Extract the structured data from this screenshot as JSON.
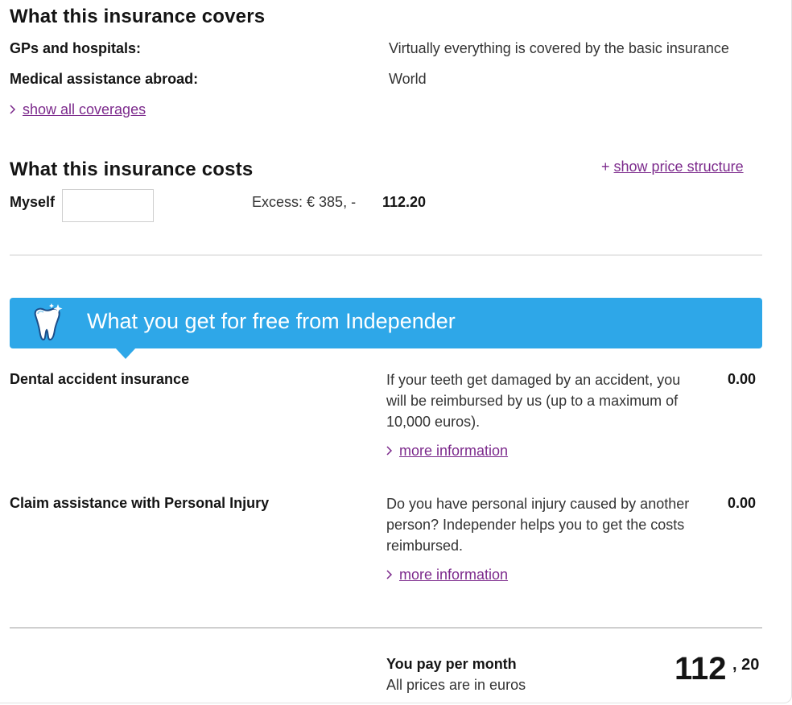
{
  "coverage": {
    "title": "What this insurance covers",
    "rows": [
      {
        "label": "GPs and hospitals:",
        "value": "Virtually everything is covered by the basic insurance"
      },
      {
        "label": "Medical assistance abroad:",
        "value": "World"
      }
    ],
    "show_all_link": "show all coverages"
  },
  "costs": {
    "title": "What this insurance costs",
    "price_structure_prefix": "+",
    "price_structure_link": "show price structure",
    "person_label": "Myself",
    "person_input_value": "",
    "excess": "Excess: € 385, -",
    "amount": "112.20"
  },
  "banner": {
    "title": "What you get for free from Independer",
    "icon": "tooth-sparkle-icon",
    "color": "#2ea7e8"
  },
  "extras": [
    {
      "name": "Dental accident insurance",
      "description": "If your teeth get damaged by an accident, you will be reimbursed by us (up to a maximum of 10,000 euros).",
      "price": "0.00",
      "link": "more information"
    },
    {
      "name": "Claim assistance with Personal Injury",
      "description": "Do you have personal injury caused by another person? Independer helps you to get the costs reimbursed.",
      "price": "0.00",
      "link": "more information"
    }
  ],
  "total": {
    "label": "You pay per month",
    "note": "All prices are in euros",
    "whole": "112",
    "cents": ", 20"
  },
  "colors": {
    "link": "#7c2a8c",
    "accent": "#2ea7e8"
  }
}
